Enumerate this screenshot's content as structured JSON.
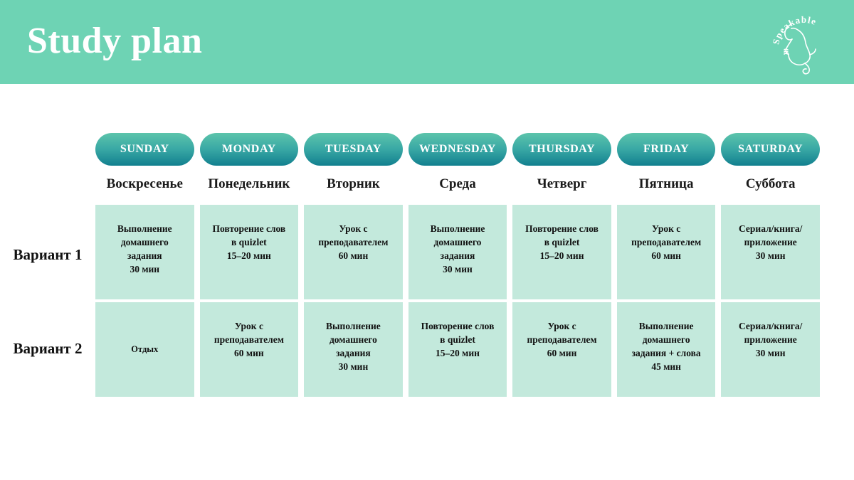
{
  "header": {
    "title": "Study plan",
    "bg_color": "#6ed3b4",
    "logo": {
      "brand": "Speakable",
      "icon": "face-profile-line-art-icon"
    }
  },
  "colors": {
    "header_green": "#6ed3b4",
    "pill_gradient_top": "#5cc4ab",
    "pill_gradient_bottom": "#12808f",
    "cell_bg": "#c3e9dc",
    "text_dark": "#111111",
    "text_light": "#ffffff"
  },
  "days": [
    {
      "en": "SUNDAY",
      "ru": "Воскресенье"
    },
    {
      "en": "MONDAY",
      "ru": "Понедельник"
    },
    {
      "en": "TUESDAY",
      "ru": "Вторник"
    },
    {
      "en": "WEDNESDAY",
      "ru": "Среда"
    },
    {
      "en": "THURSDAY",
      "ru": "Четверг"
    },
    {
      "en": "FRIDAY",
      "ru": "Пятница"
    },
    {
      "en": "SATURDAY",
      "ru": "Суббота"
    }
  ],
  "rows": [
    {
      "label": "Вариант 1",
      "cells": [
        {
          "lines": [
            "Выполнение",
            "домашнего",
            "задания",
            "30 мин"
          ],
          "valign": "top"
        },
        {
          "lines": [
            "Повторение слов",
            "в quizlet",
            "15–20 мин"
          ],
          "valign": "top"
        },
        {
          "lines": [
            "Урок с",
            "преподавателем",
            "60 мин"
          ],
          "valign": "top"
        },
        {
          "lines": [
            "Выполнение",
            "домашнего",
            "задания",
            "30 мин"
          ],
          "valign": "top"
        },
        {
          "lines": [
            "Повторение слов",
            "в quizlet",
            "15–20 мин"
          ],
          "valign": "top"
        },
        {
          "lines": [
            "Урок с",
            "преподавателем",
            "60 мин"
          ],
          "valign": "top"
        },
        {
          "lines": [
            "Сериал/книга/",
            "приложение",
            "30 мин"
          ],
          "valign": "top"
        }
      ]
    },
    {
      "label": "Вариант 2",
      "cells": [
        {
          "lines": [
            "Отдых"
          ],
          "valign": "middle"
        },
        {
          "lines": [
            "Урок с",
            "преподавателем",
            "60 мин"
          ],
          "valign": "top"
        },
        {
          "lines": [
            "Выполнение",
            "домашнего",
            "задания",
            "30 мин"
          ],
          "valign": "top"
        },
        {
          "lines": [
            "Повторение слов",
            "в quizlet",
            "15–20 мин"
          ],
          "valign": "top"
        },
        {
          "lines": [
            "Урок с",
            "преподавателем",
            "60 мин"
          ],
          "valign": "top"
        },
        {
          "lines": [
            "Выполнение",
            "домашнего",
            "задания + слова",
            "45 мин"
          ],
          "valign": "top"
        },
        {
          "lines": [
            "Сериал/книга/",
            "приложение",
            "30 мин"
          ],
          "valign": "top"
        }
      ]
    }
  ]
}
